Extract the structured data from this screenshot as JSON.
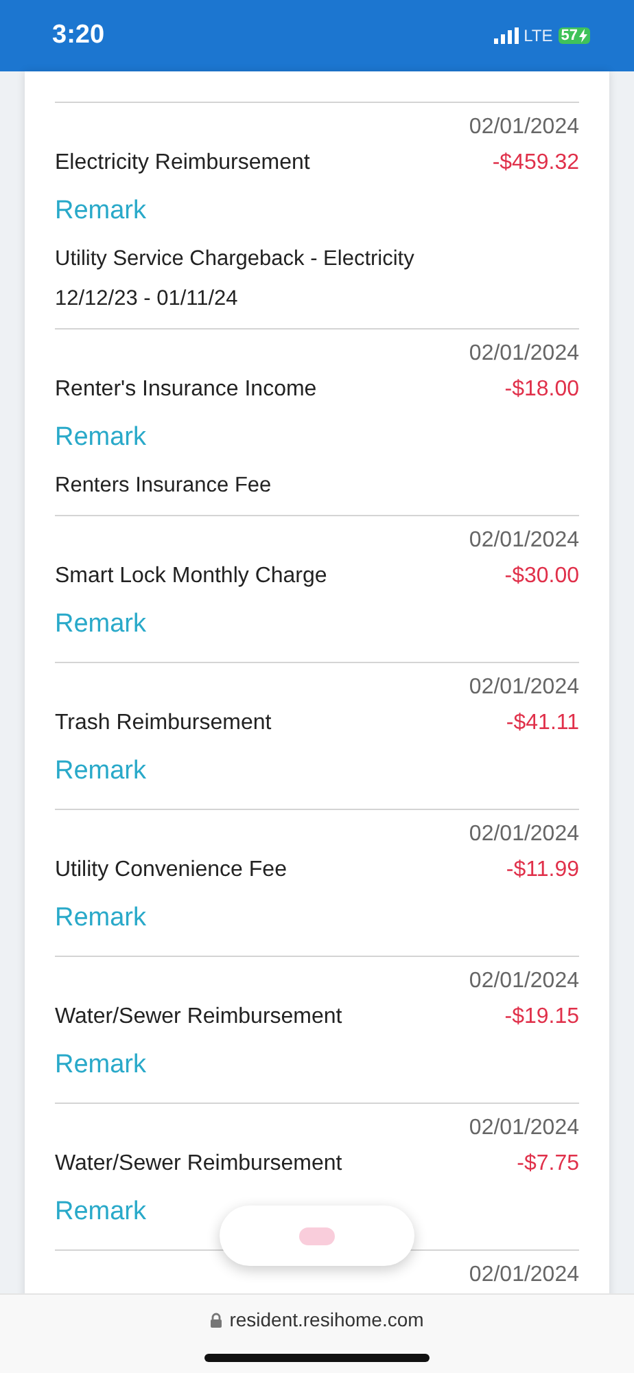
{
  "status_bar": {
    "time": "3:20",
    "network": "LTE",
    "battery": "57"
  },
  "transactions": [
    {
      "date": "02/01/2024",
      "title": "Electricity Reimbursement",
      "amount": "-$459.32",
      "remark_label": "Remark",
      "note": "Utility Service Chargeback - Electricity 12/12/23 - 01/11/24"
    },
    {
      "date": "02/01/2024",
      "title": "Renter's Insurance Income",
      "amount": "-$18.00",
      "remark_label": "Remark",
      "note": "Renters Insurance Fee"
    },
    {
      "date": "02/01/2024",
      "title": "Smart Lock Monthly Charge",
      "amount": "-$30.00",
      "remark_label": "Remark"
    },
    {
      "date": "02/01/2024",
      "title": "Trash Reimbursement",
      "amount": "-$41.11",
      "remark_label": "Remark"
    },
    {
      "date": "02/01/2024",
      "title": "Utility Convenience Fee",
      "amount": "-$11.99",
      "remark_label": "Remark"
    },
    {
      "date": "02/01/2024",
      "title": "Water/Sewer Reimbursement",
      "amount": "-$19.15",
      "remark_label": "Remark"
    },
    {
      "date": "02/01/2024",
      "title": "Water/Sewer Reimbursement",
      "amount": "-$7.75",
      "remark_label": "Remark"
    },
    {
      "date": "02/01/2024"
    }
  ],
  "browser_bar": {
    "url": "resident.resihome.com"
  }
}
